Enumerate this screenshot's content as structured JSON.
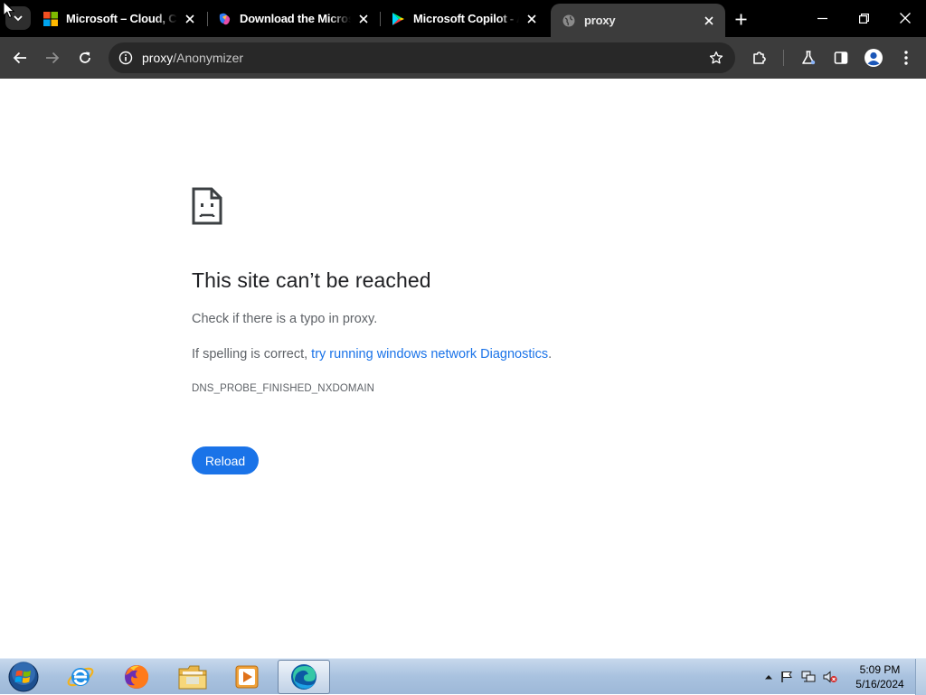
{
  "browser": {
    "tabs": [
      {
        "title": "Microsoft – Cloud, Co",
        "favicon": "microsoft-logo-icon",
        "active": false
      },
      {
        "title": "Download the Microsof",
        "favicon": "copilot-icon",
        "active": false
      },
      {
        "title": "Microsoft Copilot - Ap",
        "favicon": "google-play-icon",
        "active": false
      },
      {
        "title": "proxy",
        "favicon": "globe-icon",
        "active": true
      }
    ],
    "address_bar": {
      "host": "proxy",
      "path": "/Anonymizer"
    }
  },
  "error_page": {
    "title": "This site can’t be reached",
    "line1": "Check if there is a typo in proxy.",
    "line2_prefix": "If spelling is correct, ",
    "line2_link": "try running windows network Diagnostics",
    "line2_suffix": ".",
    "error_code": "DNS_PROBE_FINISHED_NXDOMAIN",
    "reload_label": "Reload"
  },
  "taskbar": {
    "apps": [
      "internet-explorer-icon",
      "firefox-icon",
      "file-explorer-icon",
      "media-player-icon",
      "edge-icon"
    ],
    "clock_time": "5:09 PM",
    "clock_date": "5/16/2024"
  },
  "colors": {
    "accent": "#1a73e8",
    "tabstrip": "#000000",
    "toolbar": "#3c3c3c"
  }
}
